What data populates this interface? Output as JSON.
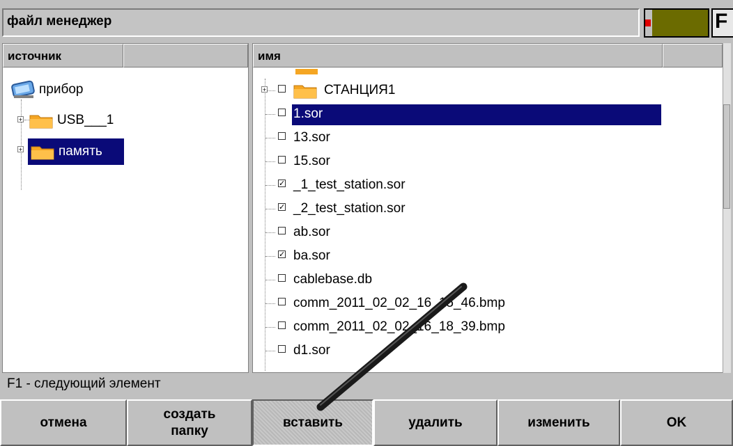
{
  "window": {
    "title": "файл менеджер",
    "fkey_label": "F"
  },
  "left_panel": {
    "headers": [
      "источник",
      ""
    ],
    "items": [
      {
        "label": "прибор",
        "icon": "device-icon"
      },
      {
        "label": "USB___1",
        "icon": "folder-icon",
        "expandable": true
      },
      {
        "label": "память",
        "icon": "folder-icon",
        "expandable": true,
        "selected": true
      }
    ]
  },
  "right_panel": {
    "headers": [
      "имя",
      ""
    ],
    "items": [
      {
        "label": "СТАНЦИЯ1",
        "type": "folder",
        "checked": false,
        "expandable": true
      },
      {
        "label": "1.sor",
        "checked": false,
        "selected": true
      },
      {
        "label": "13.sor",
        "checked": false
      },
      {
        "label": "15.sor",
        "checked": false
      },
      {
        "label": "_1_test_station.sor",
        "checked": true
      },
      {
        "label": "_2_test_station.sor",
        "checked": true
      },
      {
        "label": "ab.sor",
        "checked": false
      },
      {
        "label": "ba.sor",
        "checked": true
      },
      {
        "label": "cablebase.db",
        "checked": false
      },
      {
        "label": "comm_2011_02_02_16_15_46.bmp",
        "checked": false
      },
      {
        "label": "comm_2011_02_02_16_18_39.bmp",
        "checked": false
      },
      {
        "label": "d1.sor",
        "checked": false
      }
    ]
  },
  "status": {
    "hint": "F1 - следующий элемент"
  },
  "buttons": [
    {
      "label": "отмена"
    },
    {
      "label": "создать\nпапку"
    },
    {
      "label": "вставить",
      "pressed": true
    },
    {
      "label": "удалить"
    },
    {
      "label": "изменить"
    },
    {
      "label": "OK"
    }
  ],
  "colors": {
    "selection": "#0a0a78",
    "folder": "#f5a623",
    "battery_level": "#6b6b00",
    "battery_low": "#e00000"
  }
}
